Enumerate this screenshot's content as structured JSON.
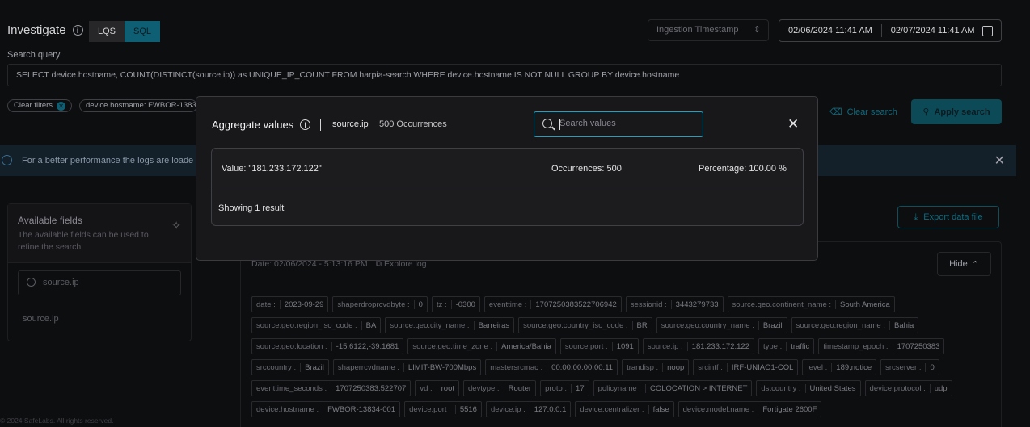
{
  "header": {
    "title": "Investigate",
    "modes": [
      "LQS",
      "SQL"
    ],
    "active_mode": "SQL",
    "timestamp_field": "Ingestion Timestamp",
    "date_from": "02/06/2024 11:41 AM",
    "date_to": "02/07/2024 11:41 AM"
  },
  "search": {
    "label": "Search query",
    "query": "SELECT device.hostname, COUNT(DISTINCT(source.ip)) as UNIQUE_IP_COUNT FROM harpia-search WHERE device.hostname IS NOT NULL GROUP BY device.hostname",
    "clear_filters": "Clear filters",
    "filter_chip": "device.hostname: FWBOR-1383",
    "clear_search": "Clear search",
    "apply_search": "Apply search"
  },
  "banner": {
    "text": "For a better performance the logs are loade"
  },
  "fields_panel": {
    "title": "Available fields",
    "subtitle": "The available fields can be used to refine the search",
    "search_value": "source.ip",
    "items": [
      "source.ip"
    ]
  },
  "log": {
    "export_label": "Export data file",
    "date_label": "Date: 02/06/2024 - 5:13:16 PM",
    "explore_label": "Explore log",
    "hide_label": "Hide",
    "rows": [
      [
        [
          "date :",
          "2023-09-29"
        ],
        [
          "shaperdroprcvdbyte :",
          "0"
        ],
        [
          "tz :",
          "-0300"
        ],
        [
          "eventtime :",
          "1707250383522706942"
        ],
        [
          "sessionid :",
          "3443279733"
        ],
        [
          "source.geo.continent_name :",
          "South America"
        ]
      ],
      [
        [
          "source.geo.region_iso_code :",
          "BA"
        ],
        [
          "source.geo.city_name :",
          "Barreiras"
        ],
        [
          "source.geo.country_iso_code :",
          "BR"
        ],
        [
          "source.geo.country_name :",
          "Brazil"
        ],
        [
          "source.geo.region_name :",
          "Bahia"
        ]
      ],
      [
        [
          "source.geo.location :",
          "-15.6122,-39.1681"
        ],
        [
          "source.geo.time_zone :",
          "America/Bahia"
        ],
        [
          "source.port :",
          "1091"
        ],
        [
          "source.ip :",
          "181.233.172.122"
        ],
        [
          "type :",
          "traffic"
        ],
        [
          "timestamp_epoch :",
          "1707250383"
        ]
      ],
      [
        [
          "srccountry :",
          "Brazil"
        ],
        [
          "shaperrcvdname :",
          "LIMIT-BW-700Mbps"
        ],
        [
          "mastersrcmac :",
          "00:00:00:00:00:11"
        ],
        [
          "trandisp :",
          "noop"
        ],
        [
          "srcintf :",
          "IRF-UNIAO1-COL"
        ],
        [
          "level :",
          "189,notice"
        ],
        [
          "srcserver :",
          "0"
        ]
      ],
      [
        [
          "eventtime_seconds :",
          "1707250383.522707"
        ],
        [
          "vd :",
          "root"
        ],
        [
          "devtype :",
          "Router"
        ],
        [
          "proto :",
          "17"
        ],
        [
          "policyname :",
          "COLOCATION > INTERNET"
        ],
        [
          "dstcountry :",
          "United States"
        ],
        [
          "device.protocol :",
          "udp"
        ]
      ],
      [
        [
          "device.hostname :",
          "FWBOR-13834-001"
        ],
        [
          "device.port :",
          "5516"
        ],
        [
          "device.ip :",
          "127.0.0.1"
        ],
        [
          "device.centralizer :",
          "false"
        ],
        [
          "device.model.name :",
          "Fortigate 2600F"
        ]
      ]
    ]
  },
  "footer": {
    "copyright": "© 2024 SafeLabs. All rights reserved."
  },
  "modal": {
    "title": "Aggregate values",
    "field": "source.ip",
    "occurrences": "500 Occurrences",
    "search_placeholder": "Search values",
    "row": {
      "value": "Value: \"181.233.172.122\"",
      "occurrences": "Occurrences: 500",
      "percentage": "Percentage: 100.00 %"
    },
    "footer": "Showing 1 result"
  }
}
